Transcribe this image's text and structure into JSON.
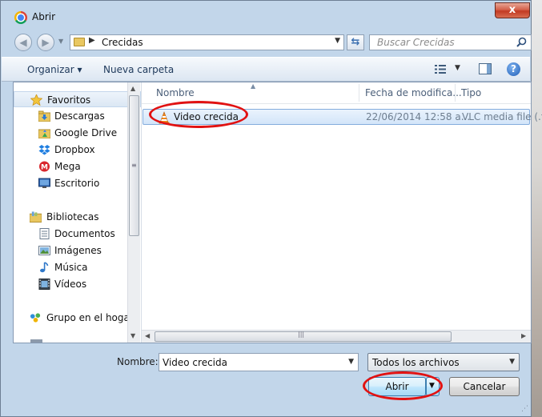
{
  "window": {
    "title": "Abrir",
    "close_label": "x"
  },
  "address": {
    "current_folder": "Crecidas",
    "search_placeholder": "Buscar Crecidas"
  },
  "toolbar": {
    "organize_label": "Organizar",
    "new_folder_label": "Nueva carpeta"
  },
  "navigation": {
    "favorites": {
      "label": "Favoritos",
      "icon": "star-icon",
      "items": [
        {
          "label": "Descargas",
          "icon": "downloads-folder-icon"
        },
        {
          "label": "Google Drive",
          "icon": "google-drive-icon"
        },
        {
          "label": "Dropbox",
          "icon": "dropbox-icon"
        },
        {
          "label": "Mega",
          "icon": "mega-icon"
        },
        {
          "label": "Escritorio",
          "icon": "desktop-icon"
        }
      ]
    },
    "libraries": {
      "label": "Bibliotecas",
      "icon": "libraries-icon",
      "items": [
        {
          "label": "Documentos",
          "icon": "documents-icon"
        },
        {
          "label": "Imágenes",
          "icon": "pictures-icon"
        },
        {
          "label": "Música",
          "icon": "music-icon"
        },
        {
          "label": "Vídeos",
          "icon": "videos-icon"
        }
      ]
    },
    "homegroup": {
      "label": "Grupo en el hogar",
      "icon": "homegroup-icon"
    }
  },
  "file_list": {
    "columns": [
      "Nombre",
      "Fecha de modifica...",
      "Tipo"
    ],
    "rows": [
      {
        "name": "Video crecida",
        "date": "22/06/2014 12:58 a...",
        "type": "VLC media file (.f",
        "icon": "vlc-icon",
        "selected": true
      }
    ]
  },
  "footer": {
    "name_label": "Nombre:",
    "name_value": "Video crecida",
    "filter_value": "Todos los archivos",
    "open_label": "Abrir",
    "cancel_label": "Cancelar"
  },
  "colors": {
    "window_frame": "#c2d6ea",
    "selection": "#d3e5f9",
    "annotation_ring": "#e11212"
  }
}
